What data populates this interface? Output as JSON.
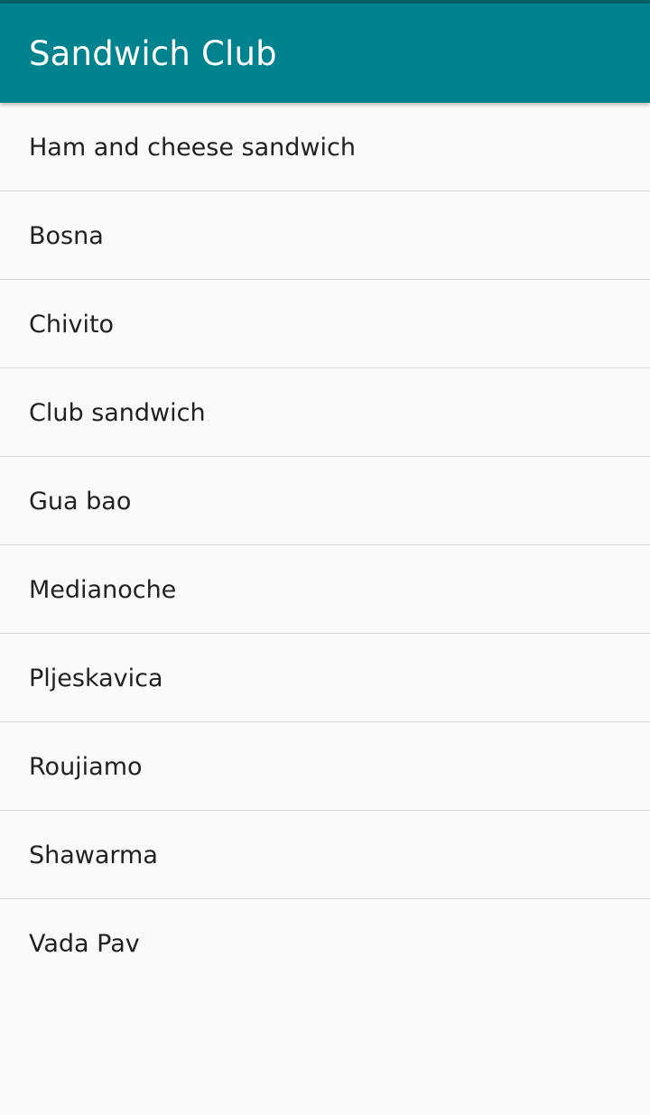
{
  "app_bar": {
    "title": "Sandwich Club",
    "color": "#00838f"
  },
  "sandwiches": [
    {
      "label": "Ham and cheese sandwich"
    },
    {
      "label": "Bosna"
    },
    {
      "label": "Chivito"
    },
    {
      "label": "Club sandwich"
    },
    {
      "label": "Gua bao"
    },
    {
      "label": "Medianoche"
    },
    {
      "label": "Pljeskavica"
    },
    {
      "label": "Roujiamo"
    },
    {
      "label": "Shawarma"
    },
    {
      "label": "Vada Pav"
    }
  ]
}
